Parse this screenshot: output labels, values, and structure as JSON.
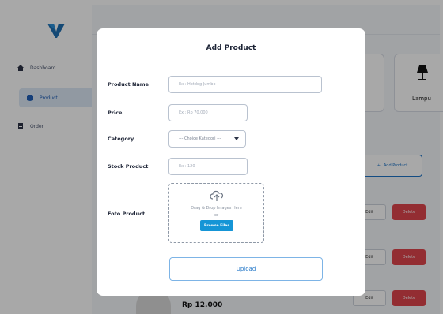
{
  "sidebar": {
    "logo_icon": "logo-icon",
    "items": [
      {
        "label": "Dashboard",
        "icon": "home-icon"
      },
      {
        "label": "Product",
        "icon": "box-icon"
      },
      {
        "label": "Order",
        "icon": "clipboard-icon"
      }
    ]
  },
  "background": {
    "category_label": "Lampu",
    "add_product_label": "Add Product",
    "rows": [
      {
        "edit_label": "Edit",
        "delete_label": "Delete"
      },
      {
        "edit_label": "Edit",
        "delete_label": "Delete"
      },
      {
        "edit_label": "Edit",
        "delete_label": "Delete"
      }
    ],
    "visible_price": "Rp 12.000"
  },
  "modal": {
    "title": "Add Product",
    "fields": {
      "name": {
        "label": "Product Name",
        "placeholder": "Ex : Hotdog Jumbo",
        "value": ""
      },
      "price": {
        "label": "Price",
        "placeholder": "Ex : Rp 70.000",
        "value": ""
      },
      "category": {
        "label": "Category",
        "selected": "--- Choice Kategori ---"
      },
      "stock": {
        "label": "Stock Product",
        "placeholder": "Ex : 120",
        "value": ""
      },
      "photo": {
        "label": "Foto Product",
        "drop_text": "Drag & Drop Images Here",
        "or_text": "or",
        "browse_label": "Browse Files"
      }
    },
    "upload_label": "Upload"
  },
  "colors": {
    "accent": "#1e74c7",
    "browse": "#1595d6",
    "delete": "#e0454d",
    "logo": "#1f6fb2"
  }
}
